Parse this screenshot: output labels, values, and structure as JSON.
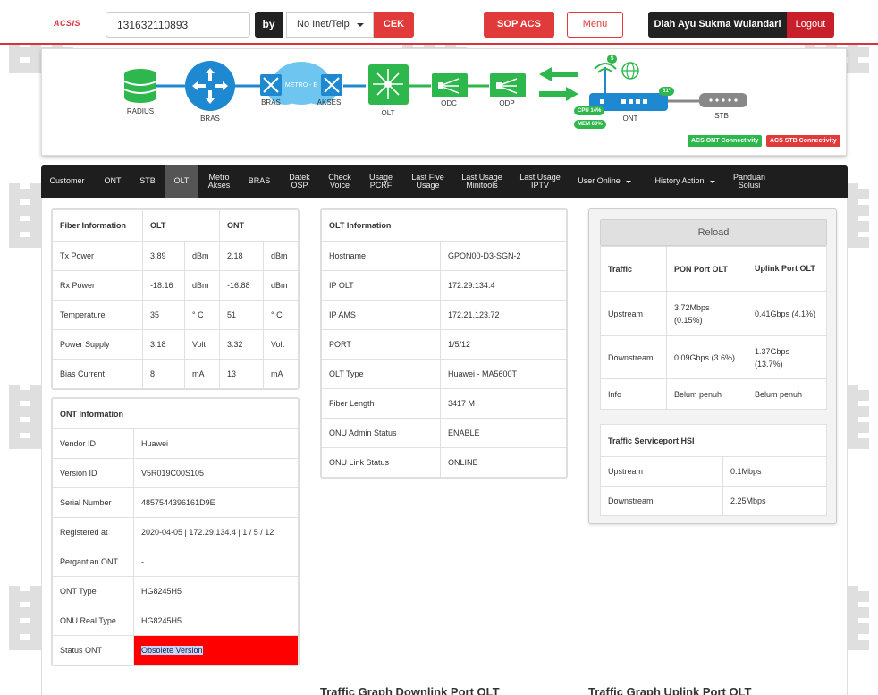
{
  "header": {
    "logo": "ACSIS",
    "search_value": "131632110893",
    "by_label": "by",
    "by_select": "No Inet/Telp",
    "cek_label": "CEK",
    "sop_label": "SOP ACS",
    "menu_label": "Menu",
    "user_name": "Diah Ayu Sukma Wulandari",
    "logout_label": "Logout"
  },
  "topology": {
    "radius": "RADIUS",
    "bras": "BRAS",
    "bras2": "BRAS",
    "metro": "METRO - E",
    "akses": "AKSES",
    "olt": "OLT",
    "odc": "ODC",
    "odp": "ODP",
    "ont": "ONT",
    "stb": "STB",
    "cpu": "CPU 14%",
    "mem": "MEM 60%",
    "temp": "61°",
    "dollar": "$",
    "acs_ont": "ACS ONT Connectivity",
    "acs_stb": "ACS STB Connectivity",
    "colors": {
      "green": "#2eb74c",
      "blue": "#1e88d0",
      "red": "#e03a3a"
    }
  },
  "nav": {
    "items": [
      {
        "label": "Customer"
      },
      {
        "label": "ONT"
      },
      {
        "label": "STB"
      },
      {
        "label": "OLT"
      },
      {
        "label": "Metro Akses"
      },
      {
        "label": "BRAS"
      },
      {
        "label": "Datek OSP"
      },
      {
        "label": "Check Voice"
      },
      {
        "label": "Usage PCRF"
      },
      {
        "label": "Last Five Usage"
      },
      {
        "label": "Last Usage Minitools"
      },
      {
        "label": "Last Usage IPTV"
      },
      {
        "label": "User Online"
      },
      {
        "label": "History Action"
      },
      {
        "label": "Panduan Solusi"
      }
    ]
  },
  "fiber": {
    "header": [
      "Fiber Information",
      "OLT",
      "ONT"
    ],
    "rows": [
      {
        "label": "Tx Power",
        "olt": "3.89",
        "olt_unit": "dBm",
        "ont": "2.18",
        "ont_unit": "dBm"
      },
      {
        "label": "Rx Power",
        "olt": "-18.16",
        "olt_unit": "dBm",
        "ont": "-16.88",
        "ont_unit": "dBm"
      },
      {
        "label": "Temperature",
        "olt": "35",
        "olt_unit": "° C",
        "ont": "51",
        "ont_unit": "° C"
      },
      {
        "label": "Power Supply",
        "olt": "3.18",
        "olt_unit": "Volt",
        "ont": "3.32",
        "ont_unit": "Volt"
      },
      {
        "label": "Bias Current",
        "olt": "8",
        "olt_unit": "mA",
        "ont": "13",
        "ont_unit": "mA"
      }
    ]
  },
  "ont_info": {
    "title": "ONT Information",
    "rows": [
      {
        "label": "Vendor ID",
        "value": "Huawei"
      },
      {
        "label": "Version ID",
        "value": "V5R019C00S105"
      },
      {
        "label": "Serial Number",
        "value": "4857544396161D9E"
      },
      {
        "label": "Registered at",
        "value": "2020-04-05 | 172.29.134.4 | 1 / 5 / 12"
      },
      {
        "label": "Pergantian ONT",
        "value": "-"
      },
      {
        "label": "ONT Type",
        "value": "HG8245H5"
      },
      {
        "label": "ONU Real Type",
        "value": "HG8245H5"
      },
      {
        "label": "Status ONT",
        "value": "Obsolete Version"
      }
    ]
  },
  "olt_info": {
    "title": "OLT Information",
    "rows": [
      {
        "label": "Hostname",
        "value": "GPON00-D3-SGN-2"
      },
      {
        "label": "IP OLT",
        "value": "172.29.134.4"
      },
      {
        "label": "IP AMS",
        "value": "172.21.123.72"
      },
      {
        "label": "PORT",
        "value": "1/5/12"
      },
      {
        "label": "OLT Type",
        "value": "Huawei - MA5600T"
      },
      {
        "label": "Fiber Length",
        "value": "3417 M"
      },
      {
        "label": "ONU Admin Status",
        "value": "ENABLE"
      },
      {
        "label": "ONU Link Status",
        "value": "ONLINE"
      }
    ]
  },
  "traffic": {
    "reload_label": "Reload",
    "header": [
      "Traffic",
      "PON Port OLT",
      "Uplink Port OLT"
    ],
    "rows": [
      {
        "label": "Upstream",
        "pon": "3.72Mbps (0.15%)",
        "uplink": "0.41Gbps (4.1%)"
      },
      {
        "label": "Downstream",
        "pon": "0.09Gbps (3.6%)",
        "uplink": "1.37Gbps (13.7%)"
      },
      {
        "label": "Info",
        "pon": "Belum penuh",
        "uplink": "Belum penuh"
      }
    ],
    "hsi_title": "Traffic Serviceport HSI",
    "hsi_rows": [
      {
        "label": "Upstream",
        "value": "0.1Mbps"
      },
      {
        "label": "Downstream",
        "value": "2.25Mbps"
      }
    ]
  },
  "graphs": {
    "downlink_title": "Traffic Graph Downlink Port OLT",
    "uplink_title": "Traffic Graph Uplink Port OLT"
  }
}
